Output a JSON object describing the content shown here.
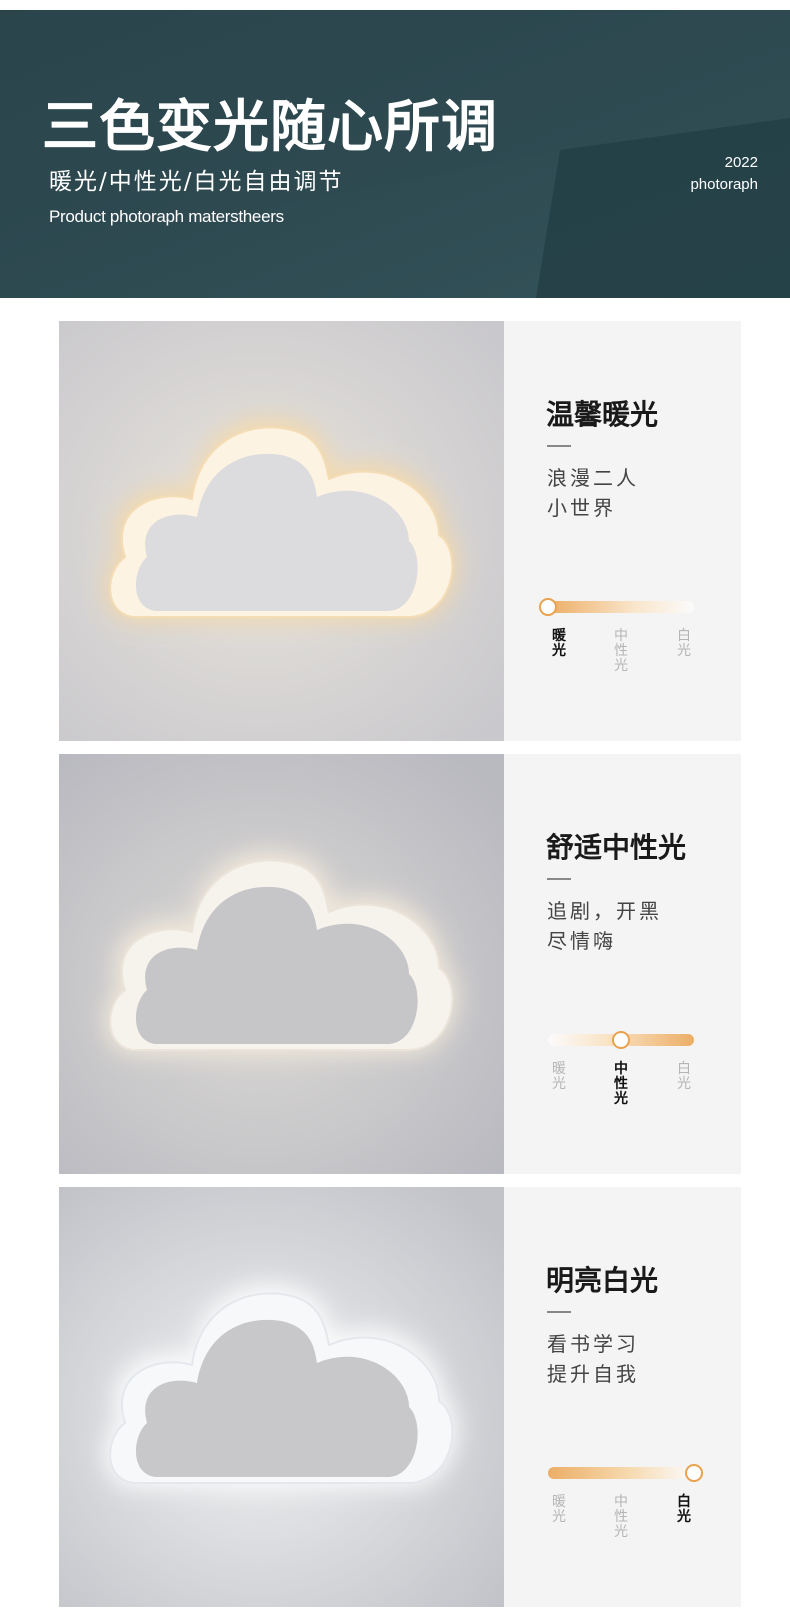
{
  "banner": {
    "title": "三色变光随心所调",
    "subtitle": "暖光/中性光/白光自由调节",
    "english": "Product photoraph materstheers",
    "year": "2022",
    "photo_label": "photoraph",
    "bg_color": "#2f4b52"
  },
  "panels": [
    {
      "title": "温馨暖光",
      "desc_line1": "浪漫二人",
      "desc_line2": "小世界",
      "slider_position": 0,
      "labels": [
        "暖光",
        "中性光",
        "白光"
      ],
      "active_label": 0,
      "light_tone": "warm"
    },
    {
      "title": "舒适中性光",
      "desc_line1": "追剧，开黑",
      "desc_line2": "尽情嗨",
      "slider_position": 0.5,
      "labels": [
        "暖光",
        "中性光",
        "白光"
      ],
      "active_label": 1,
      "light_tone": "neutral"
    },
    {
      "title": "明亮白光",
      "desc_line1": "看书学习",
      "desc_line2": "提升自我",
      "slider_position": 1,
      "labels": [
        "暖光",
        "中性光",
        "白光"
      ],
      "active_label": 2,
      "light_tone": "white"
    }
  ],
  "colors": {
    "accent": "#e9a24f",
    "panel_bg": "#f4f4f4",
    "title_text": "#1a1a1a"
  }
}
